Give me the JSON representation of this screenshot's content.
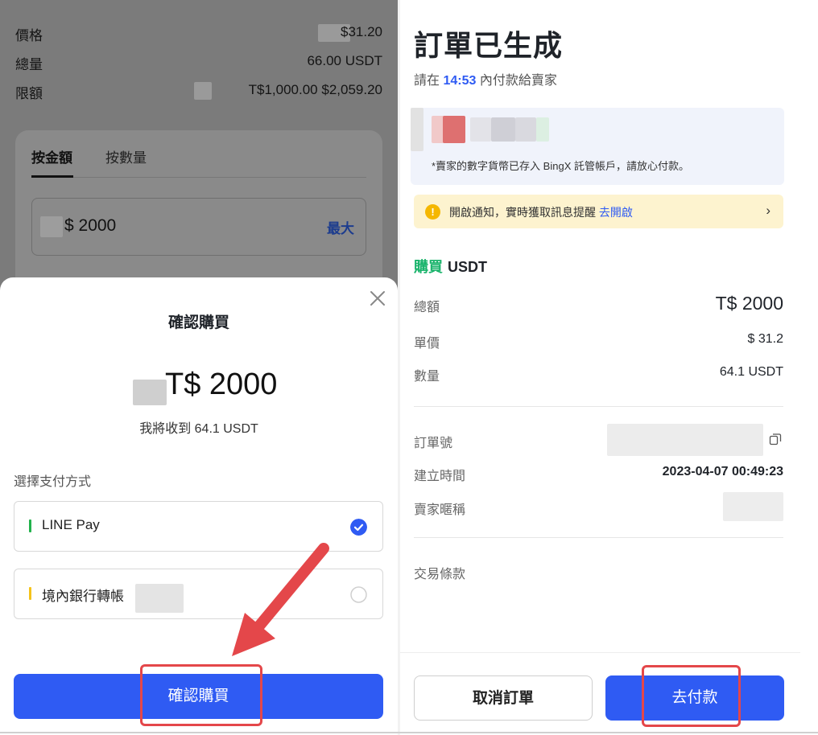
{
  "left_screen": {
    "info_rows": [
      {
        "label": "價格",
        "value": "$31.20"
      },
      {
        "label": "總量",
        "value": "66.00 USDT"
      },
      {
        "label": "限額",
        "value": "T$1,000.00  $2,059.20"
      }
    ],
    "tabs": [
      "按金額",
      "按數量"
    ],
    "amount_input": "$ 2000",
    "max_label": "最大",
    "confirm_sheet": {
      "title": "確認購買",
      "amount": "T$ 2000",
      "receive_text": "我將收到 64.1 USDT",
      "payment_label": "選擇支付方式",
      "payment_options": [
        {
          "name": "LINE Pay",
          "selected": true,
          "bar_color": "#22b24c"
        },
        {
          "name": "境內銀行轉帳",
          "selected": false,
          "bar_color": "#f5c31b"
        }
      ],
      "confirm_button": "確認購買"
    }
  },
  "right_screen": {
    "title": "訂單已生成",
    "pay_hint_prefix": "請在",
    "pay_hint_time": "14:53",
    "pay_hint_suffix": "內付款給賣家",
    "seller_note": "*賣家的數字貨幣已存入 BingX 託管帳戶，請放心付款。",
    "notice": {
      "text": "開啟通知，實時獲取訊息提醒",
      "link": "去開啟",
      "icon": "exclamation-icon"
    },
    "trade_side": "購買",
    "trade_coin": "USDT",
    "details": [
      {
        "label": "總額",
        "value": "T$ 2000"
      },
      {
        "label": "單價",
        "value": "$ 31.2"
      },
      {
        "label": "數量",
        "value": "64.1 USDT"
      }
    ],
    "order_info": [
      {
        "label": "訂單號",
        "value": ""
      },
      {
        "label": "建立時間",
        "value": "2023-04-07 00:49:23"
      },
      {
        "label": "賣家暱稱",
        "value": ""
      }
    ],
    "terms_label": "交易條款",
    "cancel_button": "取消訂單",
    "pay_button": "去付款"
  },
  "colors": {
    "primary": "#2f5bf3",
    "buy_green": "#19b36b",
    "highlight_red": "#e4474a",
    "notice_bg": "#fdf3cf"
  }
}
